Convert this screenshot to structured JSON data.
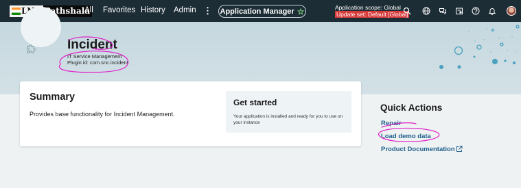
{
  "nav": {
    "logo_lng": "LNG",
    "logo_pathshala": "Pathshala",
    "items": [
      "All",
      "Favorites",
      "History",
      "Admin"
    ],
    "kebab": "⋮",
    "app_manager": "Application Manager",
    "scope_label": "Application scope: Global",
    "update_set": "Update set: Default [Global]",
    "icons": [
      "search-icon",
      "globe-icon",
      "chat-icon",
      "clipboard-icon",
      "help-icon",
      "bell-icon",
      "avatar"
    ]
  },
  "hero": {
    "title": "Incident",
    "subtitle": "IT Service Management",
    "plugin_id": "Plugin id: com.snc.incident"
  },
  "summary": {
    "title": "Summary",
    "description": "Provides base functionality for Incident Management."
  },
  "get_started": {
    "title": "Get started",
    "text": "Your application is installed and ready for you to use on your instance"
  },
  "quick_actions": {
    "title": "Quick Actions",
    "links": [
      "Repair",
      "Load demo data",
      "Product Documentation"
    ]
  },
  "colors": {
    "nav_bg": "#1d2d36",
    "link": "#1f5f8b",
    "annotation": "#e020c8",
    "update_set_bg": "#d83a3a",
    "star": "#7fd37f"
  }
}
